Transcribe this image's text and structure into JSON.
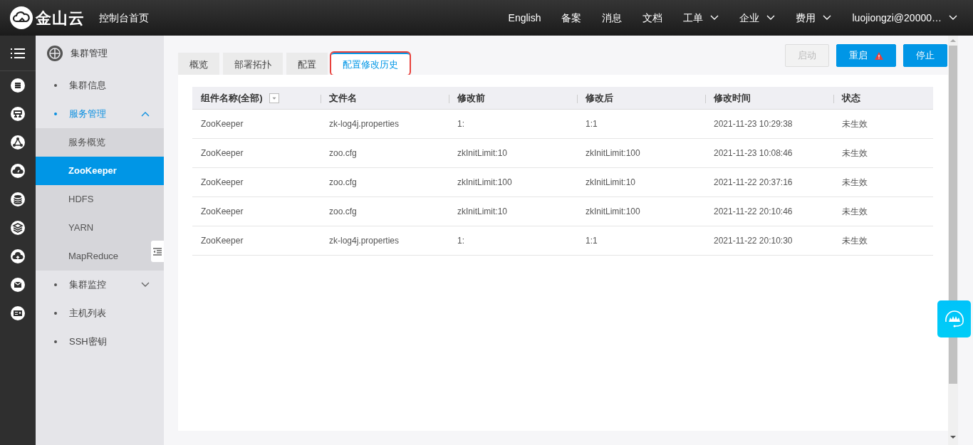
{
  "header": {
    "logo_text": "金山云",
    "console_link": "控制台首页",
    "nav": [
      {
        "label": "English",
        "dropdown": false
      },
      {
        "label": "备案",
        "dropdown": false
      },
      {
        "label": "消息",
        "dropdown": false
      },
      {
        "label": "文档",
        "dropdown": false
      },
      {
        "label": "工单",
        "dropdown": true
      },
      {
        "label": "企业",
        "dropdown": true
      },
      {
        "label": "费用",
        "dropdown": true
      },
      {
        "label": "luojiongzi@20000…",
        "dropdown": true
      }
    ]
  },
  "sidebar": {
    "title": "集群管理",
    "items": [
      {
        "label": "集群信息",
        "kind": "link",
        "selected": false
      },
      {
        "label": "服务管理",
        "kind": "group",
        "expanded": true,
        "selected": true,
        "children": [
          {
            "label": "服务概览",
            "selected": false
          },
          {
            "label": "ZooKeeper",
            "selected": true
          },
          {
            "label": "HDFS",
            "selected": false
          },
          {
            "label": "YARN",
            "selected": false
          },
          {
            "label": "MapReduce",
            "selected": false
          }
        ]
      },
      {
        "label": "集群监控",
        "kind": "group",
        "expanded": false,
        "selected": false
      },
      {
        "label": "主机列表",
        "kind": "link",
        "selected": false
      },
      {
        "label": "SSH密钥",
        "kind": "link",
        "selected": false
      }
    ]
  },
  "tabs": [
    {
      "label": "概览",
      "selected": false,
      "highlighted": false
    },
    {
      "label": "部署拓扑",
      "selected": false,
      "highlighted": false
    },
    {
      "label": "配置",
      "selected": false,
      "highlighted": false
    },
    {
      "label": "配置修改历史",
      "selected": true,
      "highlighted": true
    }
  ],
  "buttons": [
    {
      "label": "启动",
      "disabled": true,
      "alert": false
    },
    {
      "label": "重启",
      "disabled": false,
      "alert": true
    },
    {
      "label": "停止",
      "disabled": false,
      "alert": false
    }
  ],
  "table": {
    "columns": [
      {
        "label": "组件名称(全部)",
        "filter": true
      },
      {
        "label": "文件名",
        "filter": false
      },
      {
        "label": "修改前",
        "filter": false
      },
      {
        "label": "修改后",
        "filter": false
      },
      {
        "label": "修改时间",
        "filter": false
      },
      {
        "label": "状态",
        "filter": false
      }
    ],
    "rows": [
      [
        "ZooKeeper",
        "zk-log4j.properties",
        "1:",
        "1:1",
        "2021-11-23 10:29:38",
        "未生效"
      ],
      [
        "ZooKeeper",
        "zoo.cfg",
        "zkInitLimit:10",
        "zkInitLimit:100",
        "2021-11-23 10:08:46",
        "未生效"
      ],
      [
        "ZooKeeper",
        "zoo.cfg",
        "zkInitLimit:100",
        "zkInitLimit:10",
        "2021-11-22 20:37:16",
        "未生效"
      ],
      [
        "ZooKeeper",
        "zoo.cfg",
        "zkInitLimit:10",
        "zkInitLimit:100",
        "2021-11-22 20:10:46",
        "未生效"
      ],
      [
        "ZooKeeper",
        "zk-log4j.properties",
        "1:",
        "1:1",
        "2021-11-22 20:10:30",
        "未生效"
      ]
    ]
  }
}
